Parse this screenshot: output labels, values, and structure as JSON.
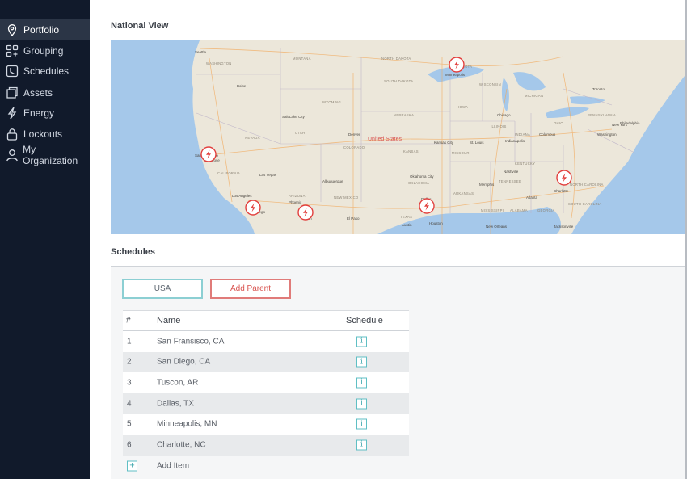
{
  "sidebar": {
    "items": [
      {
        "label": "Portfolio",
        "icon": "map-pin-icon",
        "active": true
      },
      {
        "label": "Grouping",
        "icon": "grouping-icon",
        "active": false
      },
      {
        "label": "Schedules",
        "icon": "clock-icon",
        "active": false
      },
      {
        "label": "Assets",
        "icon": "asset-icon",
        "active": false
      },
      {
        "label": "Energy",
        "icon": "lightning-icon",
        "active": false
      },
      {
        "label": "Lockouts",
        "icon": "lock-icon",
        "active": false
      },
      {
        "label": "My Organization",
        "icon": "person-icon",
        "active": false
      }
    ]
  },
  "national_view": {
    "title": "National View",
    "map": {
      "states": [
        "WASHINGTON",
        "MONTANA",
        "NORTH DAKOTA",
        "MINNESOTA",
        "SOUTH DAKOTA",
        "WISCONSIN",
        "WYOMING",
        "NEBRASKA",
        "IOWA",
        "NEVADA",
        "UTAH",
        "COLORADO",
        "KANSAS",
        "MISSOURI",
        "ILLINOIS",
        "INDIANA",
        "OHIO",
        "KENTUCKY",
        "TENNESSEE",
        "CALIFORNIA",
        "ARIZONA",
        "NEW MEXICO",
        "OKLAHOMA",
        "ARKANSAS",
        "MISSISSIPPI",
        "ALABAMA",
        "GEORGIA",
        "TEXAS",
        "NORTH CAROLINA",
        "SOUTH CAROLINA",
        "MICHIGAN",
        "PENNSYLVANIA"
      ],
      "cities": [
        "Seattle",
        "Minneapolis",
        "Toronto",
        "Chicago",
        "Denver",
        "Kansas City",
        "St. Louis",
        "Indianapolis",
        "Columbus",
        "Washington",
        "Philadelphia",
        "New York",
        "Las Vegas",
        "Los Angeles",
        "San Diego",
        "Phoenix",
        "Tucson",
        "El Paso",
        "Dallas",
        "Austin",
        "Houston",
        "Nashville",
        "Atlanta",
        "Charlotte",
        "San Jose",
        "San Francisco",
        "Salt Lake City",
        "Boise",
        "Oklahoma City",
        "Memphis",
        "New Orleans",
        "Jacksonville",
        "Albuquerque"
      ],
      "country_label": "United States",
      "marker_icon": "lightning-marker-icon"
    }
  },
  "schedules": {
    "title": "Schedules",
    "usa_button": "USA",
    "add_parent_button": "Add Parent",
    "table": {
      "headers": {
        "num": "#",
        "name": "Name",
        "schedule": "Schedule"
      },
      "rows": [
        {
          "num": "1",
          "name": "San Fransisco, CA"
        },
        {
          "num": "2",
          "name": "San Diego, CA"
        },
        {
          "num": "3",
          "name": "Tuscon, AR"
        },
        {
          "num": "4",
          "name": "Dallas, TX"
        },
        {
          "num": "5",
          "name": "Minneapolis, MN"
        },
        {
          "num": "6",
          "name": "Charlotte, NC"
        }
      ],
      "info_glyph": "i",
      "add_glyph": "+",
      "add_item_label": "Add Item"
    }
  },
  "colors": {
    "sidebar_bg": "#111a2b",
    "sidebar_active": "#2b3546",
    "accent_teal": "#5fbfc4",
    "accent_red": "#d9534f",
    "marker_red": "#e2403e",
    "water": "#a5c8ea",
    "land": "#ece7da"
  }
}
